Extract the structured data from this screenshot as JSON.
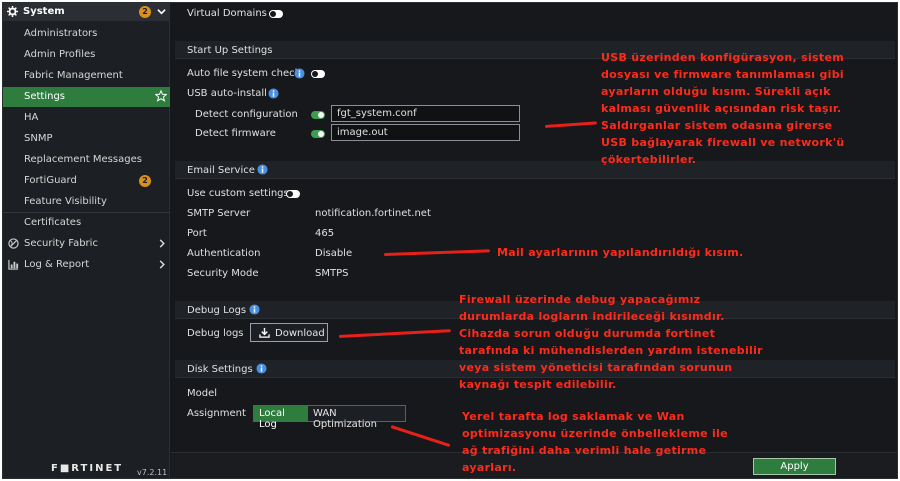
{
  "sidebar": {
    "header": {
      "label": "System",
      "badge": "2"
    },
    "items": [
      {
        "label": "Administrators"
      },
      {
        "label": "Admin Profiles"
      },
      {
        "label": "Fabric Management"
      },
      {
        "label": "Settings",
        "active": true
      },
      {
        "label": "HA"
      },
      {
        "label": "SNMP"
      },
      {
        "label": "Replacement Messages"
      },
      {
        "label": "FortiGuard",
        "badge": "2"
      },
      {
        "label": "Feature Visibility"
      },
      {
        "label": "Certificates"
      },
      {
        "label": "Security Fabric"
      },
      {
        "label": "Log & Report"
      }
    ],
    "brand": "F■RTINET",
    "version": "v7.2.11"
  },
  "main": {
    "virtual_domains": {
      "label": "Virtual Domains",
      "enabled": false
    },
    "startup": {
      "title": "Start Up Settings",
      "auto_fs_check": {
        "label": "Auto file system check",
        "enabled": false
      },
      "usb_auto_install": "USB auto-install",
      "detect_config": {
        "label": "Detect configuration",
        "enabled": true,
        "value": "fgt_system.conf"
      },
      "detect_firmware": {
        "label": "Detect firmware",
        "enabled": true,
        "value": "image.out"
      }
    },
    "email": {
      "title": "Email Service",
      "use_custom": {
        "label": "Use custom settings",
        "enabled": false
      },
      "smtp_label": "SMTP Server",
      "smtp_value": "notification.fortinet.net",
      "port_label": "Port",
      "port_value": "465",
      "auth_label": "Authentication",
      "auth_value": "Disable",
      "mode_label": "Security Mode",
      "mode_value": "SMTPS"
    },
    "debug": {
      "title": "Debug Logs",
      "label": "Debug logs",
      "download_label": "Download"
    },
    "disk": {
      "title": "Disk Settings",
      "model_label": "Model",
      "assignment_label": "Assignment",
      "options": [
        "Local Log",
        "WAN Optimization"
      ],
      "selected": "Local Log"
    },
    "apply_label": "Apply"
  },
  "annotations": {
    "usb": "USB üzerinden konfigürasyon, sistem\ndosyası ve firmware tanımlaması gibi\nayarların olduğu kısım. Sürekli açık\nkalması güvenlik açısından risk taşır.\nSaldırganlar sistem odasına girerse\nUSB bağlayarak firewall ve network'ü\nçökertebilirler.",
    "mail": "Mail ayarlarının yapılandırıldığı kısım.",
    "debug": "Firewall üzerinde debug yapacağımız\ndurumlarda logların indirileceği kısımdır.\nCihazda sorun olduğu durumda fortinet\ntarafında ki mühendislerden yardım istenebilir\nveya sistem yöneticisi tarafından sorunun\nkaynağı tespit edilebilir.",
    "disk": "Yerel tarafta log saklamak ve Wan\noptimizasyonu üzerinde önbellekleme ile\nağ trafiğini daha verimli hale getirme\nayarları."
  },
  "colors": {
    "accent": "#2e7d3f",
    "annotation": "#ff2a1a",
    "badge": "#d9901f"
  }
}
